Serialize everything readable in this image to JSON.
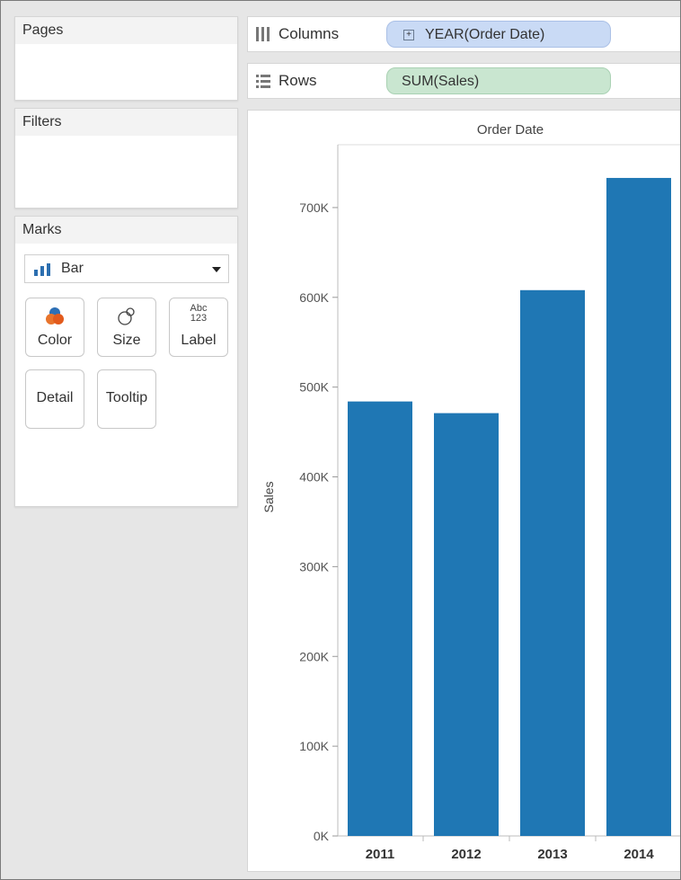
{
  "panels": {
    "pages_title": "Pages",
    "filters_title": "Filters",
    "marks_title": "Marks"
  },
  "marks": {
    "type_selected": "Bar",
    "buttons": {
      "color": "Color",
      "size": "Size",
      "label": "Label",
      "label_icon_text_top": "Abc",
      "label_icon_text_bottom": "123",
      "detail": "Detail",
      "tooltip": "Tooltip"
    }
  },
  "shelves": {
    "columns_label": "Columns",
    "columns_pill": "YEAR(Order Date)",
    "rows_label": "Rows",
    "rows_pill": "SUM(Sales)"
  },
  "colors": {
    "bar": "#1f77b4",
    "columns_pill": "#c9daf5",
    "rows_pill": "#c9e6d0"
  },
  "chart_data": {
    "type": "bar",
    "title": "Order Date",
    "xlabel": "",
    "ylabel": "Sales",
    "categories": [
      "2011",
      "2012",
      "2013",
      "2014"
    ],
    "values": [
      484000,
      471000,
      608000,
      733000
    ],
    "ylim": [
      0,
      770000
    ],
    "yticks": [
      0,
      100000,
      200000,
      300000,
      400000,
      500000,
      600000,
      700000
    ],
    "ytick_labels": [
      "0K",
      "100K",
      "200K",
      "300K",
      "400K",
      "500K",
      "600K",
      "700K"
    ],
    "grid": false,
    "legend": "none"
  }
}
